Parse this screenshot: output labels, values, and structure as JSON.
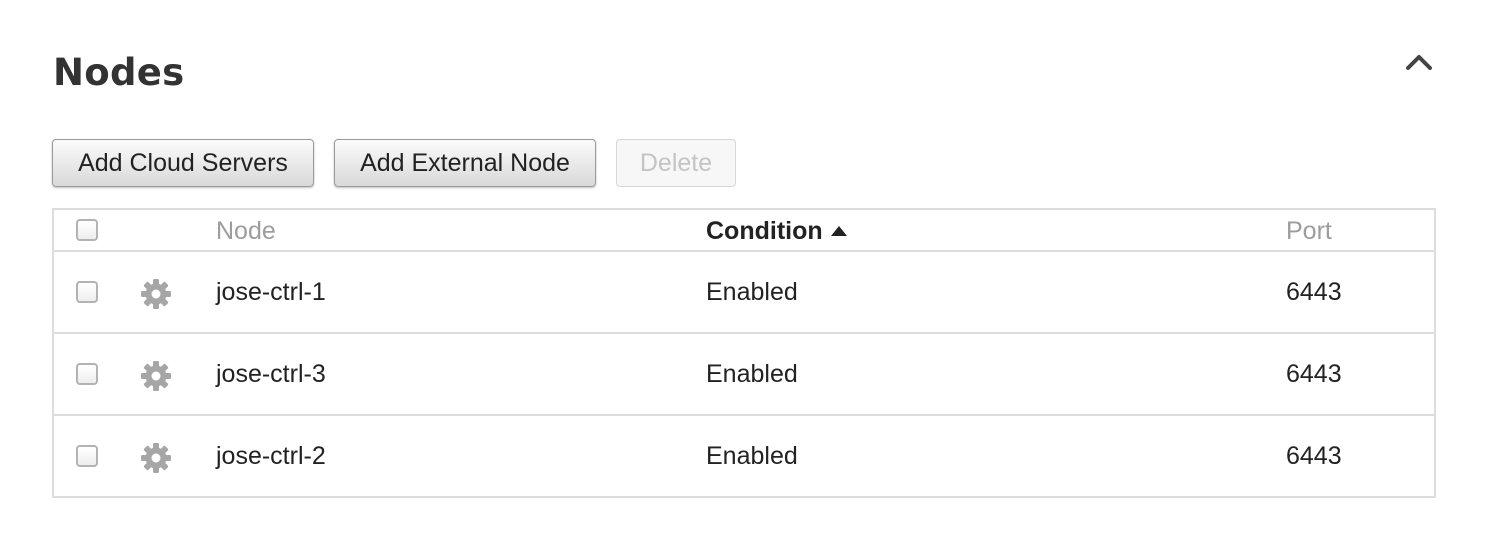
{
  "section": {
    "title": "Nodes",
    "collapse_icon": "chevron-up-icon"
  },
  "toolbar": {
    "add_cloud_label": "Add Cloud Servers",
    "add_external_label": "Add External Node",
    "delete_label": "Delete",
    "delete_disabled": true
  },
  "table": {
    "columns": {
      "node": "Node",
      "condition": "Condition",
      "port": "Port"
    },
    "sorted_by": "Condition",
    "sort_direction": "ascending",
    "rows": [
      {
        "node": "jose-ctrl-1",
        "condition": "Enabled",
        "port": "6443",
        "checked": false,
        "icon": "gear-icon"
      },
      {
        "node": "jose-ctrl-3",
        "condition": "Enabled",
        "port": "6443",
        "checked": false,
        "icon": "gear-icon"
      },
      {
        "node": "jose-ctrl-2",
        "condition": "Enabled",
        "port": "6443",
        "checked": false,
        "icon": "gear-icon"
      }
    ]
  },
  "colors": {
    "title": "#333333",
    "muted_header": "#9d9d9d",
    "border": "#dcdcdc",
    "gear": "#a6a6a6"
  }
}
